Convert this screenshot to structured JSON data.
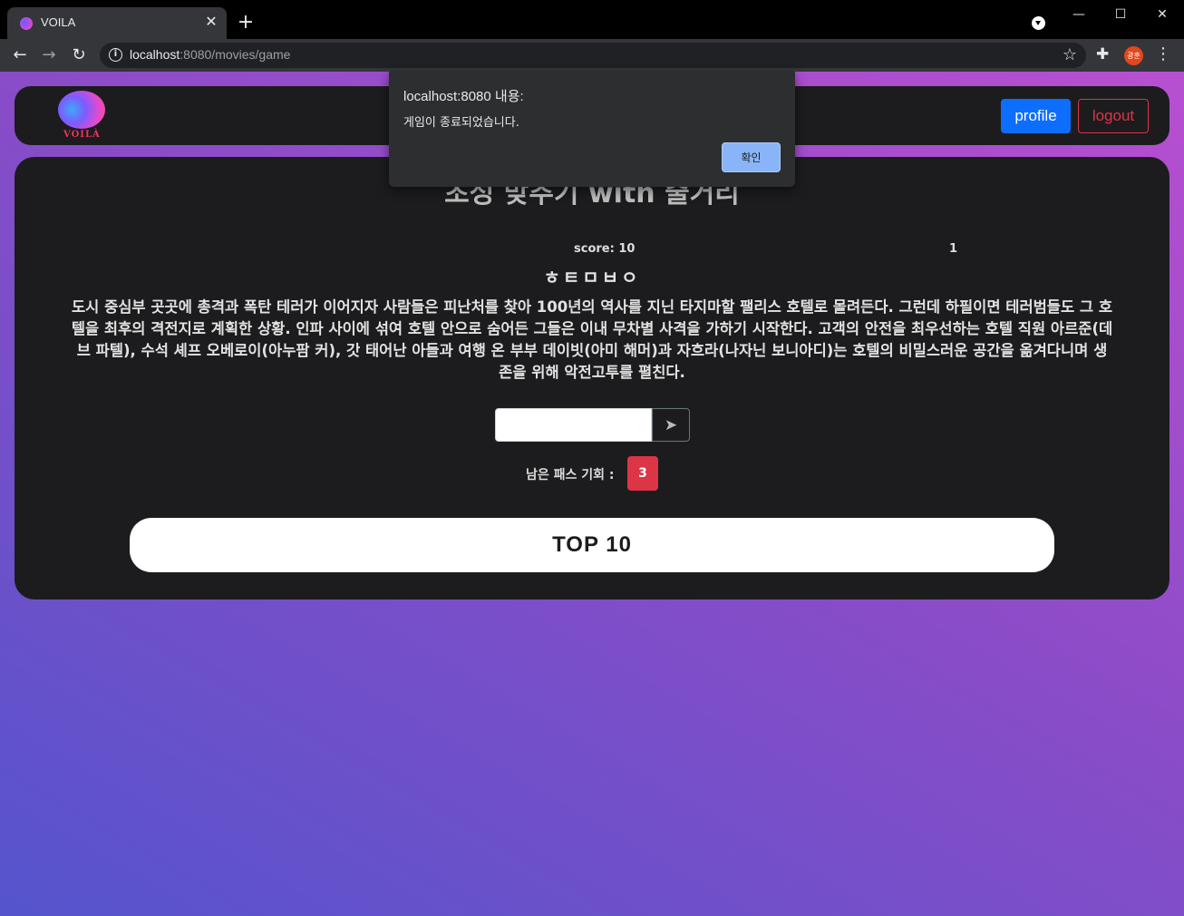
{
  "browser": {
    "tab_title": "VOILA",
    "tab_close": "✕",
    "new_tab": "+",
    "url_host": "localhost",
    "url_rest": ":8080/movies/game",
    "avatar_text": "광훈",
    "window_controls": [
      "—",
      "☐",
      "✕"
    ],
    "icons": [
      "back-icon",
      "forward-icon",
      "reload-icon",
      "info-icon",
      "star-icon",
      "extensions-icon",
      "menu-icon"
    ]
  },
  "navbar": {
    "logo_text": "VOILÀ",
    "profile_label": "profile",
    "logout_label": "logout"
  },
  "game": {
    "title": "초성 맞추기 with 줄거리",
    "score": "score: 10",
    "round": "1",
    "hint": "ㅎㅌㅁㅂㅇ",
    "plot": "도시 중심부 곳곳에 총격과 폭탄 테러가 이어지자 사람들은 피난처를 찾아 100년의 역사를 지닌 타지마할 팰리스 호텔로 몰려든다. 그런데 하필이면 테러범들도 그 호텔을 최후의 격전지로 계획한 상황. 인파 사이에 섞여 호텔 안으로 숨어든 그들은 이내 무차별 사격을 가하기 시작한다. 고객의 안전을 최우선하는 호텔 직원 아르준(데브 파텔), 수석 셰프 오베로이(아누팜 커), 갓 태어난 아들과 여행 온 부부 데이빗(아미 해머)과 자흐라(나자닌 보니아디)는 호텔의 비밀스러운 공간을 옮겨다니며 생존을 위해 악전고투를 펼친다.",
    "answer_value": "",
    "pass_label": "남은 패스 기회 :",
    "pass_count": "3",
    "top10_label": "TOP 10"
  },
  "dialog": {
    "title": "localhost:8080 내용:",
    "message": "게임이 종료되었습니다.",
    "ok_label": "확인"
  },
  "colors": {
    "primary": "#0d6efd",
    "danger": "#dc3545",
    "card_bg": "#1c1c1e",
    "gradient_top": "#b84fd1",
    "gradient_bottom": "#5554cc"
  }
}
